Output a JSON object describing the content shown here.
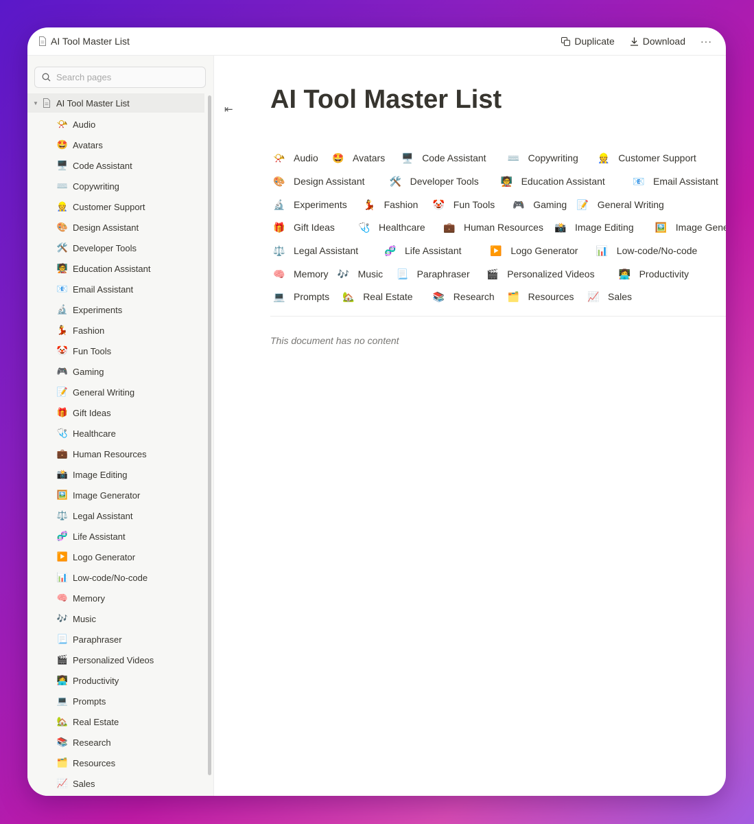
{
  "window": {
    "title": "AI Tool Master List",
    "actions": {
      "duplicate": "Duplicate",
      "download": "Download",
      "more": "···"
    }
  },
  "sidebar": {
    "search_placeholder": "Search pages",
    "root": "AI Tool Master List",
    "items": [
      {
        "emoji": "📯",
        "label": "Audio"
      },
      {
        "emoji": "🤩",
        "label": "Avatars"
      },
      {
        "emoji": "🖥️",
        "label": "Code Assistant"
      },
      {
        "emoji": "⌨️",
        "label": "Copywriting"
      },
      {
        "emoji": "👷",
        "label": "Customer Support"
      },
      {
        "emoji": "🎨",
        "label": "Design Assistant"
      },
      {
        "emoji": "🛠️",
        "label": "Developer Tools"
      },
      {
        "emoji": "🧑‍🏫",
        "label": "Education Assistant"
      },
      {
        "emoji": "📧",
        "label": "Email Assistant"
      },
      {
        "emoji": "🔬",
        "label": "Experiments"
      },
      {
        "emoji": "💃",
        "label": "Fashion"
      },
      {
        "emoji": "🤡",
        "label": "Fun Tools"
      },
      {
        "emoji": "🎮",
        "label": "Gaming"
      },
      {
        "emoji": "📝",
        "label": "General Writing"
      },
      {
        "emoji": "🎁",
        "label": "Gift Ideas"
      },
      {
        "emoji": "🩺",
        "label": "Healthcare"
      },
      {
        "emoji": "💼",
        "label": "Human Resources"
      },
      {
        "emoji": "📸",
        "label": "Image Editing"
      },
      {
        "emoji": "🖼️",
        "label": "Image Generator"
      },
      {
        "emoji": "⚖️",
        "label": "Legal Assistant"
      },
      {
        "emoji": "🧬",
        "label": "Life Assistant"
      },
      {
        "emoji": "▶️",
        "label": "Logo Generator"
      },
      {
        "emoji": "📊",
        "label": "Low-code/No-code"
      },
      {
        "emoji": "🧠",
        "label": "Memory"
      },
      {
        "emoji": "🎶",
        "label": "Music"
      },
      {
        "emoji": "📃",
        "label": "Paraphraser"
      },
      {
        "emoji": "🎬",
        "label": "Personalized Videos"
      },
      {
        "emoji": "👩‍💻",
        "label": "Productivity"
      },
      {
        "emoji": "💻",
        "label": "Prompts"
      },
      {
        "emoji": "🏡",
        "label": "Real Estate"
      },
      {
        "emoji": "📚",
        "label": "Research"
      },
      {
        "emoji": "🗂️",
        "label": "Resources"
      },
      {
        "emoji": "📈",
        "label": "Sales"
      }
    ]
  },
  "main": {
    "title": "AI Tool Master List",
    "empty_note": "This document has no content",
    "tag_rows": [
      [
        {
          "emoji": "📯",
          "label": "Audio"
        },
        {
          "emoji": "🤩",
          "label": "Avatars"
        },
        {
          "emoji": "🖥️",
          "label": "Code Assistant"
        },
        {
          "emoji": "⌨️",
          "label": "Copywriting"
        },
        {
          "emoji": "👷",
          "label": "Customer Support"
        }
      ],
      [
        {
          "emoji": "🎨",
          "label": "Design Assistant"
        },
        {
          "emoji": "🛠️",
          "label": "Developer Tools"
        },
        {
          "emoji": "🧑‍🏫",
          "label": "Education Assistant"
        },
        {
          "emoji": "📧",
          "label": "Email Assistant"
        }
      ],
      [
        {
          "emoji": "🔬",
          "label": "Experiments"
        },
        {
          "emoji": "💃",
          "label": "Fashion"
        },
        {
          "emoji": "🤡",
          "label": "Fun Tools"
        },
        {
          "emoji": "🎮",
          "label": "Gaming"
        },
        {
          "emoji": "📝",
          "label": "General Writing"
        }
      ],
      [
        {
          "emoji": "🎁",
          "label": "Gift Ideas"
        },
        {
          "emoji": "🩺",
          "label": "Healthcare"
        },
        {
          "emoji": "💼",
          "label": "Human Resources"
        },
        {
          "emoji": "📸",
          "label": "Image Editing"
        },
        {
          "emoji": "🖼️",
          "label": "Image Generator"
        }
      ],
      [
        {
          "emoji": "⚖️",
          "label": "Legal Assistant"
        },
        {
          "emoji": "🧬",
          "label": "Life Assistant"
        },
        {
          "emoji": "▶️",
          "label": "Logo Generator"
        },
        {
          "emoji": "📊",
          "label": "Low-code/No-code"
        }
      ],
      [
        {
          "emoji": "🧠",
          "label": "Memory"
        },
        {
          "emoji": "🎶",
          "label": "Music"
        },
        {
          "emoji": "📃",
          "label": "Paraphraser"
        },
        {
          "emoji": "🎬",
          "label": "Personalized Videos"
        },
        {
          "emoji": "👩‍💻",
          "label": "Productivity"
        }
      ],
      [
        {
          "emoji": "💻",
          "label": "Prompts"
        },
        {
          "emoji": "🏡",
          "label": "Real Estate"
        },
        {
          "emoji": "📚",
          "label": "Research"
        },
        {
          "emoji": "🗂️",
          "label": "Resources"
        },
        {
          "emoji": "📈",
          "label": "Sales"
        }
      ]
    ]
  },
  "colors": {
    "text": "#37352f",
    "muted": "#787774",
    "sidebar_bg": "#f7f7f5"
  }
}
